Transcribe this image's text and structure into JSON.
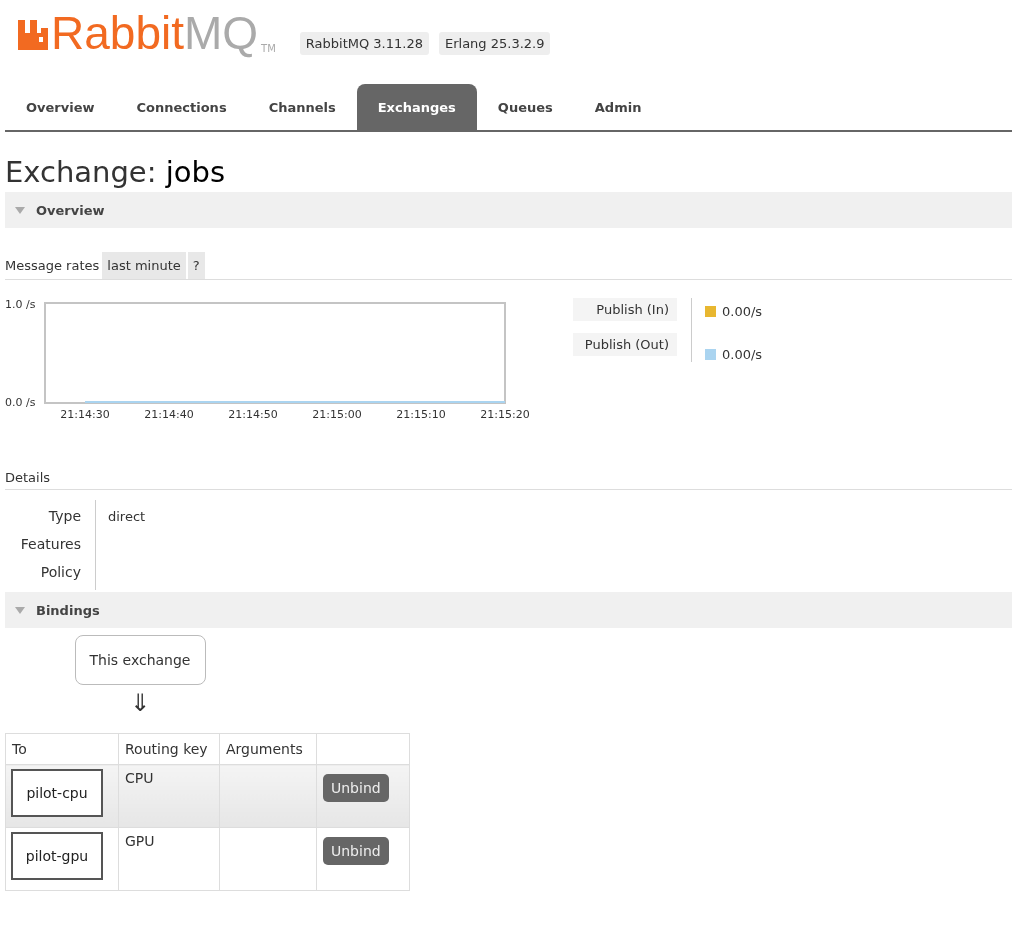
{
  "logo": {
    "word_1": "Rabbit",
    "word_2": "MQ",
    "mark": "TM"
  },
  "versions": [
    "RabbitMQ 3.11.28",
    "Erlang 25.3.2.9"
  ],
  "tabs": [
    {
      "label": "Overview",
      "selected": false
    },
    {
      "label": "Connections",
      "selected": false
    },
    {
      "label": "Channels",
      "selected": false
    },
    {
      "label": "Exchanges",
      "selected": true
    },
    {
      "label": "Queues",
      "selected": false
    },
    {
      "label": "Admin",
      "selected": false
    }
  ],
  "page_title": {
    "prefix": "Exchange:",
    "name": "jobs"
  },
  "overview": {
    "header": "Overview",
    "expanded": true,
    "rates_label": "Message rates",
    "rates_period": "last minute",
    "help": "?",
    "chart_data": {
      "type": "line",
      "x": [
        "21:14:30",
        "21:14:40",
        "21:14:50",
        "21:15:00",
        "21:15:10",
        "21:15:20"
      ],
      "ylim": [
        0,
        1
      ],
      "yticks": [
        {
          "value": 0,
          "label": "0.0 /s"
        },
        {
          "value": 1,
          "label": "1.0 /s"
        }
      ],
      "series": [
        {
          "name": "Publish (In)",
          "color": "#e8b730",
          "values": [
            null,
            null,
            null,
            null,
            null,
            null
          ]
        },
        {
          "name": "Publish (Out)",
          "color": "#aad4f0",
          "values": [
            0,
            0,
            0,
            0,
            0,
            0
          ]
        }
      ]
    },
    "legend_readings": [
      "0.00/s",
      "0.00/s"
    ]
  },
  "details": {
    "title": "Details",
    "rows": [
      {
        "label": "Type",
        "value": "direct"
      },
      {
        "label": "Features"
      },
      {
        "label": "Policy"
      }
    ]
  },
  "bindings": {
    "header": "Bindings",
    "expanded": true,
    "source": "This exchange",
    "arrow": "⇓",
    "columns": [
      "To",
      "Routing key",
      "Arguments"
    ],
    "rows": [
      {
        "to": "pilot-cpu",
        "routing_key": "CPU",
        "action": "Unbind",
        "selected": true
      },
      {
        "to": "pilot-gpu",
        "routing_key": "GPU",
        "action": "Unbind",
        "selected": false
      }
    ]
  }
}
